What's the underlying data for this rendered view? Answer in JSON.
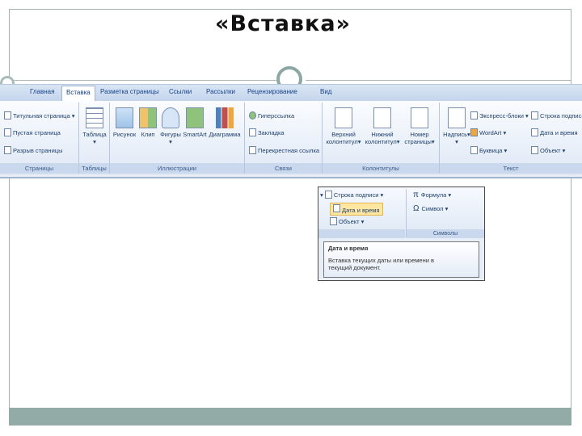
{
  "slide": {
    "title": "«Вставка»"
  },
  "ribbon": {
    "tabs": [
      "Главная",
      "Вставка",
      "Разметка страницы",
      "Ссылки",
      "Рассылки",
      "Рецензирование",
      "Вид"
    ],
    "active_tab": "Вставка",
    "groups": {
      "pages": {
        "label": "Страницы",
        "items": [
          "Титульная страница",
          "Пустая страница",
          "Разрыв страницы"
        ]
      },
      "tables": {
        "label": "Таблицы",
        "button": "Таблица"
      },
      "illustrations": {
        "label": "Иллюстрации",
        "buttons": [
          "Рисунок",
          "Клип",
          "Фигуры",
          "SmartArt",
          "Диаграмма"
        ]
      },
      "links": {
        "label": "Связи",
        "items": [
          "Гиперссылка",
          "Закладка",
          "Перекрестная ссылка"
        ]
      },
      "header_footer": {
        "label": "Колонтитулы",
        "buttons": [
          {
            "line1": "Верхний",
            "line2": "колонтитул"
          },
          {
            "line1": "Нижний",
            "line2": "колонтитул"
          },
          {
            "line1": "Номер",
            "line2": "страницы"
          }
        ]
      },
      "text": {
        "label": "Текст",
        "big_button": "Надпись",
        "col1": [
          "Экспресс-блоки",
          "WordArt",
          "Буквица"
        ],
        "col2": [
          "Строка подписи",
          "Дата и время",
          "Объект"
        ]
      }
    }
  },
  "popup": {
    "items_left": [
      "Строка подписи",
      "Дата и время",
      "Объект"
    ],
    "items_right": [
      "Формула",
      "Символ"
    ],
    "group_label_right": "Символы",
    "tooltip_title": "Дата и время",
    "tooltip_body_line1": "Вставка текущих даты или времени в",
    "tooltip_body_line2": "текущий документ."
  },
  "colors": {
    "accent": "#92aba7",
    "ribbon_text": "#15428b"
  }
}
